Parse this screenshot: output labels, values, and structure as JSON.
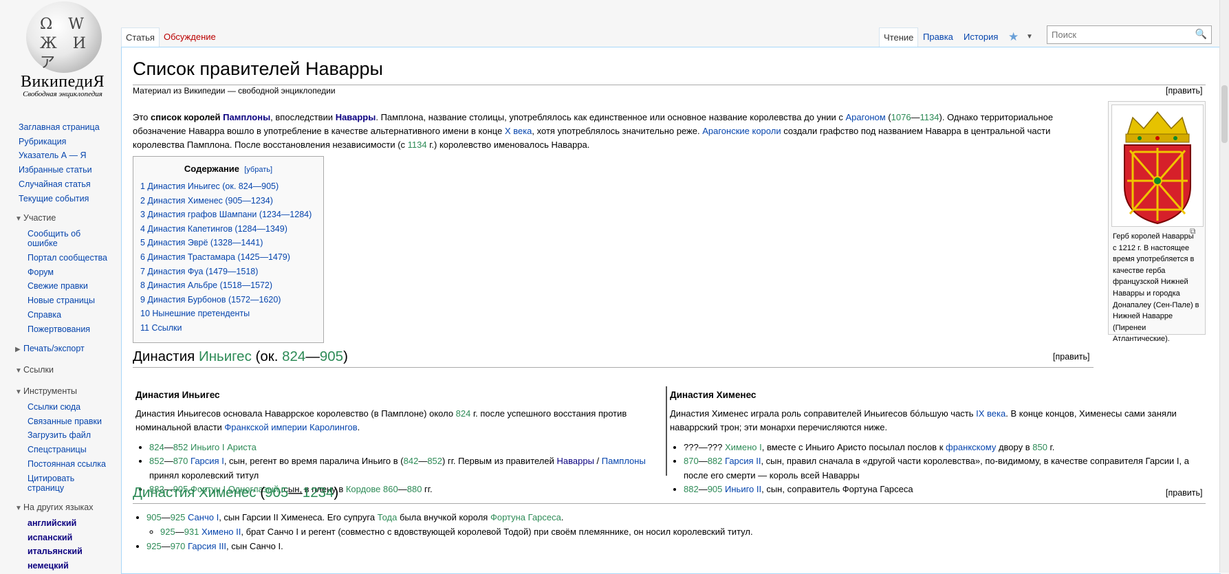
{
  "brand": {
    "wordmark": "ВикипедиЯ",
    "tagline": "Свободная энциклопедия"
  },
  "sidebar": {
    "nav": [
      "Заглавная страница",
      "Рубрикация",
      "Указатель А — Я",
      "Избранные статьи",
      "Случайная статья",
      "Текущие события"
    ],
    "participation": {
      "header": "Участие",
      "items": [
        "Сообщить об ошибке",
        "Портал сообщества",
        "Форум",
        "Свежие правки",
        "Новые страницы",
        "Справка",
        "Пожертвования"
      ]
    },
    "print_header": "Печать/экспорт",
    "links_header": "Ссылки",
    "tools": {
      "header": "Инструменты",
      "items": [
        "Ссылки сюда",
        "Связанные правки",
        "Загрузить файл",
        "Спецстраницы",
        "Постоянная ссылка",
        "Цитировать страницу"
      ]
    },
    "languages": {
      "header": "На других языках",
      "items": [
        "английский",
        "испанский",
        "итальянский",
        "немецкий"
      ]
    }
  },
  "tabs": {
    "article": "Статья",
    "talk": "Обсуждение",
    "read": "Чтение",
    "edit": "Правка",
    "history": "История"
  },
  "search": {
    "placeholder": "Поиск"
  },
  "page": {
    "title": "Список правителей Наварры",
    "subtitle": "Материал из Википедии — свободной энциклопедии",
    "edit_label": "[править]"
  },
  "intro": {
    "p1a": "Это ",
    "bold1": "список королей",
    "p1b": " ",
    "link1": "Памплоны",
    "p1c": ", впоследствии ",
    "link2": "Наварры",
    "p1d": ". Памплона, название столицы, употреблялось как единственное или основное название королевства до унии с ",
    "link3": "Арагоном",
    "p1e": " (",
    "y1": "1076",
    "dash": "—",
    "y2": "1134",
    "p1f": "). Однако территориальное обозначение Наварра вошло в употребление в качестве альтернативного имени в конце ",
    "link4": "X века",
    "p1g": ", хотя употреблялось значительно реже. ",
    "link5": "Арагонские короли",
    "p1h": " создали графство под названием Наварра в центральной части королевства Памплона. После восстановления независимости (с ",
    "y3": "1134",
    "p1i": " г.) королевство именовалось Наварра."
  },
  "toc": {
    "title": "Содержание",
    "hide": "[убрать]",
    "items": [
      "1 Династия Иньигес (ок. 824—905)",
      "2 Династия Хименес (905—1234)",
      "3 Династия графов Шампани (1234—1284)",
      "4 Династия Капетингов (1284—1349)",
      "5 Династия Эврё (1328—1441)",
      "6 Династия Трастамара (1425—1479)",
      "7 Династия Фуа (1479—1518)",
      "8 Династия Альбре (1518—1572)",
      "9 Династия Бурбонов (1572—1620)",
      "10 Нынешние претенденты",
      "11 Ссылки"
    ]
  },
  "section1": {
    "a": "Династия ",
    "b": "Иньигес",
    "c": " (ок. ",
    "d": "824",
    "e": "—",
    "f": "905",
    "g": ")"
  },
  "col_left": {
    "title": "Династия Иньигес",
    "p_a": "Династия Иньигесов основала Наваррское королевство (в Памплоне) около ",
    "p_y": "824",
    "p_b": " г. после успешного восстания против номинальной власти ",
    "p_l1": "Франкской империи",
    "p_c": " ",
    "p_l2": "Каролингов",
    "p_d": ".",
    "li1_a": "824",
    "li1_b": "—",
    "li1_c": "852",
    "li1_d": " Иньиго I Ариста",
    "li2_a": "852",
    "li2_b": "—",
    "li2_c": "870",
    "li2_d": " Гарсия I",
    "li2_e": ", сын, регент во время паралича Иньиго в (",
    "li2_f": "842",
    "li2_g": "—",
    "li2_h": "852",
    "li2_i": ") гг. Первым из правителей ",
    "li2_j": "Наварры",
    "li2_k": " / ",
    "li2_l": "Памплоны",
    "li2_m": " принял королевский титул",
    "li3_a": "882",
    "li3_b": "—",
    "li3_c": "905",
    "li3_d": " Фортун I Одноглазый",
    "li3_e": ", сын, в плену в ",
    "li3_f": "Кордове",
    "li3_g": " ",
    "li3_h": "860",
    "li3_i": "—",
    "li3_j": "880",
    "li3_k": " гг."
  },
  "col_right": {
    "title": "Династия Хименес",
    "p_a": "Династия Хименес играла роль соправителей Иньигесов бо́льшую часть ",
    "p_l": "IX века",
    "p_b": ". В конце концов, Хименесы сами заняли наваррский трон; эти монархи перечисляются ниже.",
    "li1_a": "???—??? ",
    "li1_b": "Химено I",
    "li1_c": ", вместе с Иньиго Аристо посылал послов к ",
    "li1_d": "франкскому",
    "li1_e": " двору в ",
    "li1_f": "850",
    "li1_g": " г.",
    "li2_a": "870",
    "li2_b": "—",
    "li2_c": "882",
    "li2_d": " Гарсия II",
    "li2_e": ", сын, правил сначала в «другой части королевства», по-видимому, в качестве соправителя Гарсии I, а после его смерти — король всей Наварры",
    "li3_a": "882",
    "li3_b": "—",
    "li3_c": "905",
    "li3_d": " Иньиго II",
    "li3_e": ", сын, соправитель Фортуна Гарсеса"
  },
  "section2": {
    "a": "Династия Хименес",
    "b": " (",
    "c": "905",
    "d": "—",
    "e": "1234",
    "f": ")"
  },
  "bottom": {
    "l1_a": "905",
    "l1_b": "—",
    "l1_c": "925",
    "l1_d": " Санчо I",
    "l1_e": ", сын Гарсии II Хименеса. Его супруга ",
    "l1_f": "Тода",
    "l1_g": " была внучкой короля ",
    "l1_h": "Фортуна Гарсеса",
    "l1_i": ".",
    "l2_a": "925",
    "l2_b": "—",
    "l2_c": "931",
    "l2_d": " Химено II",
    "l2_e": ", брат Санчо I и регент (совместно с вдовствующей королевой Тодой) при своём племяннике, он носил королевский титул.",
    "l3_a": "925",
    "l3_b": "—",
    "l3_c": "970",
    "l3_d": " Гарсия III",
    "l3_e": ", сын Санчо I."
  },
  "thumb": {
    "caption": "Герб королей Наварры с 1212 г. В настоящее время употребляется в качестве герба французской Нижней Наварры и городка Донапалеу (Сен-Пале) в Нижней Наварре (Пиренеи Атлантические)."
  }
}
